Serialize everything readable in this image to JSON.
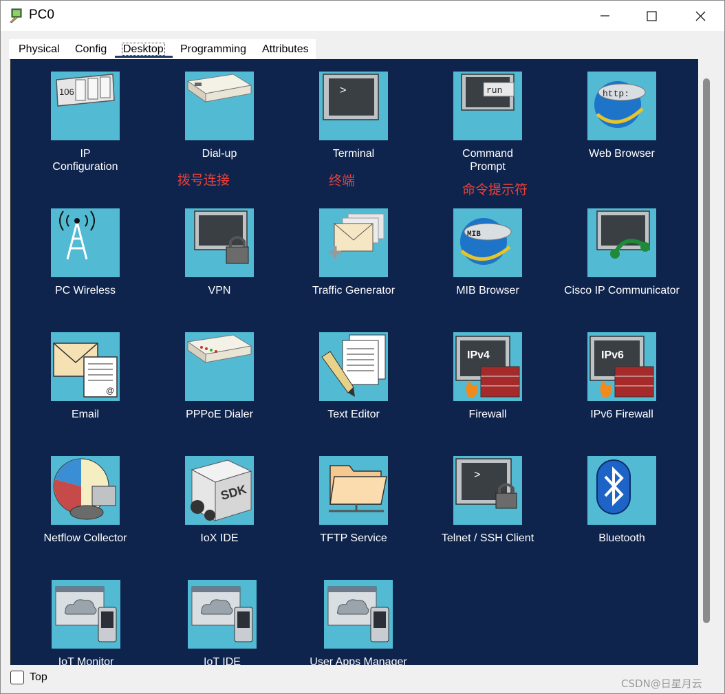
{
  "window": {
    "title": "PC0"
  },
  "tabs": [
    {
      "label": "Physical"
    },
    {
      "label": "Config"
    },
    {
      "label": "Desktop"
    },
    {
      "label": "Programming"
    },
    {
      "label": "Attributes"
    }
  ],
  "active_tab": "Desktop",
  "apps": [
    {
      "label": "IP\nConfiguration",
      "icon": "ip-configuration-icon",
      "tile_text": "106"
    },
    {
      "label": "Dial-up",
      "icon": "dial-up-modem-icon"
    },
    {
      "label": "Terminal",
      "icon": "terminal-icon",
      "tile_text": ">"
    },
    {
      "label": "Command\nPrompt",
      "icon": "command-prompt-icon",
      "tile_text": "run"
    },
    {
      "label": "Web Browser",
      "icon": "web-browser-icon",
      "tile_text": "http:"
    },
    {
      "label": "PC Wireless",
      "icon": "wireless-tower-icon"
    },
    {
      "label": "VPN",
      "icon": "vpn-lock-icon"
    },
    {
      "label": "Traffic Generator",
      "icon": "traffic-generator-icon"
    },
    {
      "label": "MIB Browser",
      "icon": "mib-browser-icon",
      "tile_text": "MIB"
    },
    {
      "label": "Cisco IP Communicator",
      "icon": "ip-communicator-headset-icon"
    },
    {
      "label": "Email",
      "icon": "email-envelope-icon",
      "tile_text": "@"
    },
    {
      "label": "PPPoE Dialer",
      "icon": "pppoe-dialer-icon"
    },
    {
      "label": "Text Editor",
      "icon": "text-editor-icon"
    },
    {
      "label": "Firewall",
      "icon": "firewall-icon",
      "tile_text": "IPv4"
    },
    {
      "label": "IPv6 Firewall",
      "icon": "ipv6-firewall-icon",
      "tile_text": "IPv6"
    },
    {
      "label": "Netflow Collector",
      "icon": "netflow-collector-icon"
    },
    {
      "label": "IoX IDE",
      "icon": "iox-ide-icon",
      "tile_text": "SDK"
    },
    {
      "label": "TFTP Service",
      "icon": "tftp-folder-icon"
    },
    {
      "label": "Telnet / SSH Client",
      "icon": "telnet-ssh-icon",
      "tile_text": ">"
    },
    {
      "label": "Bluetooth",
      "icon": "bluetooth-icon"
    },
    {
      "label": "IoT Monitor",
      "icon": "iot-monitor-icon"
    },
    {
      "label": "IoT IDE",
      "icon": "iot-ide-icon"
    },
    {
      "label": "User Apps Manager",
      "icon": "user-apps-manager-icon"
    }
  ],
  "annotations": [
    {
      "text": "拨号连接"
    },
    {
      "text": "终端"
    },
    {
      "text": "命令提示符"
    }
  ],
  "footer": {
    "top_label": "Top",
    "top_checked": false
  },
  "watermark": "CSDN@日星月云",
  "colors": {
    "panel_bg": "#0f244d",
    "tile_bg": "#52bad3",
    "annotation": "#e8413b"
  }
}
